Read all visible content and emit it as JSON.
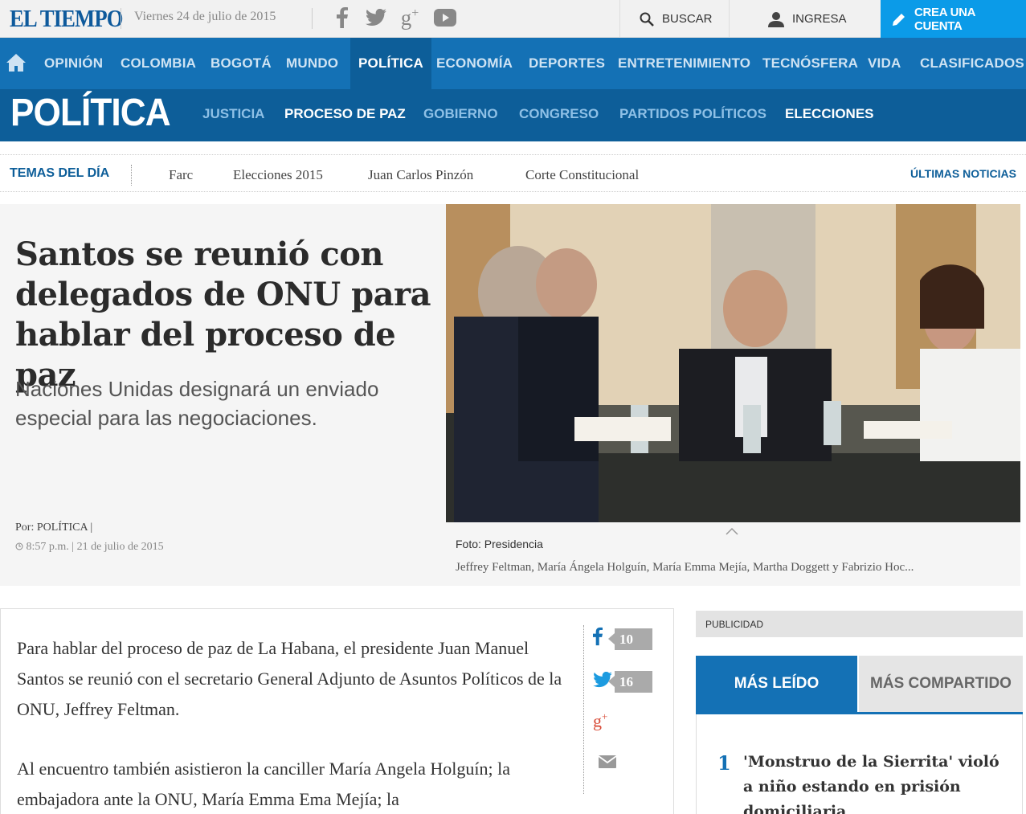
{
  "header": {
    "logo": "EL TIEMPO",
    "date": "Viernes 24 de julio de 2015",
    "social_icons": [
      "facebook-icon",
      "twitter-icon",
      "google-plus-icon",
      "youtube-icon"
    ],
    "search_label": "BUSCAR",
    "login_label": "INGRESA",
    "signup_label": "CREA UNA CUENTA"
  },
  "nav": {
    "items": [
      "OPINIÓN",
      "COLOMBIA",
      "BOGOTÁ",
      "MUNDO",
      "POLÍTICA",
      "ECONOMÍA",
      "DEPORTES",
      "ENTRETENIMIENTO",
      "TECNÓSFERA",
      "VIDA",
      "CLASIFICADOS"
    ],
    "active": "POLÍTICA"
  },
  "section": {
    "title": "POLÍTICA",
    "subnav": [
      "JUSTICIA",
      "PROCESO DE PAZ",
      "GOBIERNO",
      "CONGRESO",
      "PARTIDOS POLÍTICOS",
      "ELECCIONES"
    ]
  },
  "topics": {
    "label": "TEMAS DEL DÍA",
    "items": [
      "Farc",
      "Elecciones 2015",
      "Juan Carlos Pinzón",
      "Corte Constitucional"
    ],
    "latest_label": "ÚLTIMAS NOTICIAS"
  },
  "article": {
    "headline": "Santos se reunió con delegados de ONU para hablar del proceso de paz",
    "subheadline": "Naciones Unidas designará un enviado especial para las negociaciones.",
    "by_prefix": "Por:",
    "author": "POLÍTICA |",
    "time": "8:57 p.m. | 21 de julio de 2015",
    "photo_credit": "Foto: Presidencia",
    "photo_caption": "Jeffrey Feltman, María Ángela Holguín, María Emma Mejía, Martha Doggett y Fabrizio Hoc...",
    "paragraphs": [
      "Para hablar del proceso de paz de La Habana, el presidente Juan Manuel Santos se reunió con el secretario General Adjunto de Asuntos Políticos de la ONU, Jeffrey Feltman.",
      "Al encuentro también asistieron la canciller María Angela Holguín; la embajadora ante la ONU, María Emma Ema Mejía; la"
    ],
    "share": {
      "facebook_count": "10",
      "twitter_count": "16"
    }
  },
  "sidebar": {
    "ad_label": "PUBLICIDAD",
    "tabs": [
      "MÁS LEÍDO",
      "MÁS COMPARTIDO"
    ],
    "most_read": [
      {
        "rank": "1",
        "title": "'Monstruo de la Sierrita' violó a niño estando en prisión domiciliaria"
      }
    ]
  },
  "colors": {
    "brand_blue": "#1471b5",
    "section_blue": "#0d5e99",
    "signup_cyan": "#0b9be8"
  }
}
